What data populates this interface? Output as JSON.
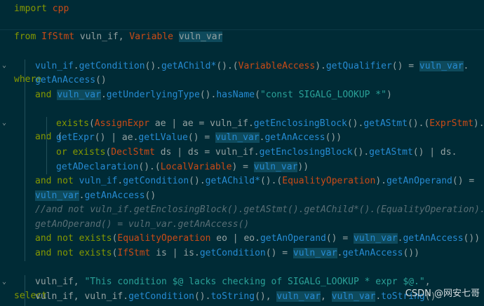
{
  "editor": {
    "lines": [
      [
        {
          "t": "import ",
          "c": "t-kw"
        },
        {
          "t": "cpp",
          "c": "t-type"
        }
      ],
      [],
      [
        {
          "t": "from ",
          "c": "t-kw"
        },
        {
          "t": "IfStmt",
          "c": "t-type"
        },
        {
          "t": " vuln_if, ",
          "c": "t-plain"
        },
        {
          "t": "Variable",
          "c": "t-type"
        },
        {
          "t": " ",
          "c": "t-plain"
        },
        {
          "t": "vuln_var",
          "c": "t-plain t-hl"
        }
      ],
      [
        {
          "t": "where",
          "c": "t-kw"
        }
      ],
      [
        {
          "t": "vuln_if",
          "c": "t-var"
        },
        {
          "t": ".",
          "c": "t-plain"
        },
        {
          "t": "getCondition",
          "c": "t-fn"
        },
        {
          "t": "().",
          "c": "t-plain"
        },
        {
          "t": "getAChild*",
          "c": "t-fn"
        },
        {
          "t": "().(",
          "c": "t-plain"
        },
        {
          "t": "VariableAccess",
          "c": "t-type"
        },
        {
          "t": ").",
          "c": "t-plain"
        },
        {
          "t": "getQualifier",
          "c": "t-fn"
        },
        {
          "t": "() = ",
          "c": "t-plain"
        },
        {
          "t": "vuln_var",
          "c": "t-var t-hl"
        },
        {
          "t": ".",
          "c": "t-plain"
        }
      ],
      [
        {
          "t": "getAnAccess",
          "c": "t-fn"
        },
        {
          "t": "()",
          "c": "t-plain"
        }
      ],
      [
        {
          "t": "and ",
          "c": "t-kw"
        },
        {
          "t": "vuln_var",
          "c": "t-var t-hl"
        },
        {
          "t": ".",
          "c": "t-plain"
        },
        {
          "t": "getUnderlyingType",
          "c": "t-fn"
        },
        {
          "t": "().",
          "c": "t-plain"
        },
        {
          "t": "hasName",
          "c": "t-fn"
        },
        {
          "t": "(",
          "c": "t-plain"
        },
        {
          "t": "\"const SIGALG_LOOKUP *\"",
          "c": "t-str"
        },
        {
          "t": ")",
          "c": "t-plain"
        }
      ],
      [
        {
          "t": "and ",
          "c": "t-kw"
        },
        {
          "t": "(",
          "c": "t-plain"
        }
      ],
      [
        {
          "t": "exists",
          "c": "t-kw"
        },
        {
          "t": "(",
          "c": "t-plain"
        },
        {
          "t": "AssignExpr",
          "c": "t-type"
        },
        {
          "t": " ae | ae = vuln_if.",
          "c": "t-plain"
        },
        {
          "t": "getEnclosingBlock",
          "c": "t-fn"
        },
        {
          "t": "().",
          "c": "t-plain"
        },
        {
          "t": "getAStmt",
          "c": "t-fn"
        },
        {
          "t": "().(",
          "c": "t-plain"
        },
        {
          "t": "ExprStmt",
          "c": "t-type"
        },
        {
          "t": ").",
          "c": "t-plain"
        }
      ],
      [
        {
          "t": "getExpr",
          "c": "t-fn"
        },
        {
          "t": "() | ae.",
          "c": "t-plain"
        },
        {
          "t": "getLValue",
          "c": "t-fn"
        },
        {
          "t": "() = ",
          "c": "t-plain"
        },
        {
          "t": "vuln_var",
          "c": "t-var t-hl"
        },
        {
          "t": ".",
          "c": "t-plain"
        },
        {
          "t": "getAnAccess",
          "c": "t-fn"
        },
        {
          "t": "())",
          "c": "t-plain"
        }
      ],
      [
        {
          "t": "or ",
          "c": "t-kw"
        },
        {
          "t": "exists",
          "c": "t-kw"
        },
        {
          "t": "(",
          "c": "t-plain"
        },
        {
          "t": "DeclStmt",
          "c": "t-type"
        },
        {
          "t": " ds | ds = vuln_if.",
          "c": "t-plain"
        },
        {
          "t": "getEnclosingBlock",
          "c": "t-fn"
        },
        {
          "t": "().",
          "c": "t-plain"
        },
        {
          "t": "getAStmt",
          "c": "t-fn"
        },
        {
          "t": "() | ds.",
          "c": "t-plain"
        }
      ],
      [
        {
          "t": "getADeclaration",
          "c": "t-fn"
        },
        {
          "t": "().(",
          "c": "t-plain"
        },
        {
          "t": "LocalVariable",
          "c": "t-type"
        },
        {
          "t": ") = ",
          "c": "t-plain"
        },
        {
          "t": "vuln_var",
          "c": "t-var t-hl"
        },
        {
          "t": "))",
          "c": "t-plain"
        }
      ],
      [
        {
          "t": "and not ",
          "c": "t-kw"
        },
        {
          "t": "vuln_if",
          "c": "t-var"
        },
        {
          "t": ".",
          "c": "t-plain"
        },
        {
          "t": "getCondition",
          "c": "t-fn"
        },
        {
          "t": "().",
          "c": "t-plain"
        },
        {
          "t": "getAChild*",
          "c": "t-fn"
        },
        {
          "t": "().(",
          "c": "t-plain"
        },
        {
          "t": "EqualityOperation",
          "c": "t-type"
        },
        {
          "t": ").",
          "c": "t-plain"
        },
        {
          "t": "getAnOperand",
          "c": "t-fn"
        },
        {
          "t": "() =",
          "c": "t-plain"
        }
      ],
      [
        {
          "t": "vuln_var",
          "c": "t-var t-hl"
        },
        {
          "t": ".",
          "c": "t-plain"
        },
        {
          "t": "getAnAccess",
          "c": "t-fn"
        },
        {
          "t": "()",
          "c": "t-plain"
        }
      ],
      [
        {
          "t": "//and not vuln_if.getEnclosingBlock().getAStmt().getAChild*().(EqualityOperation).",
          "c": "t-com"
        }
      ],
      [
        {
          "t": "getAnOperand() = vuln_var.getAnAccess()",
          "c": "t-com"
        }
      ],
      [
        {
          "t": "and not ",
          "c": "t-kw"
        },
        {
          "t": "exists",
          "c": "t-kw"
        },
        {
          "t": "(",
          "c": "t-plain"
        },
        {
          "t": "EqualityOperation",
          "c": "t-type"
        },
        {
          "t": " eo | eo.",
          "c": "t-plain"
        },
        {
          "t": "getAnOperand",
          "c": "t-fn"
        },
        {
          "t": "() = ",
          "c": "t-plain"
        },
        {
          "t": "vuln_var",
          "c": "t-var t-hl"
        },
        {
          "t": ".",
          "c": "t-plain"
        },
        {
          "t": "getAnAccess",
          "c": "t-fn"
        },
        {
          "t": "())",
          "c": "t-plain"
        }
      ],
      [
        {
          "t": "and not ",
          "c": "t-kw"
        },
        {
          "t": "exists",
          "c": "t-kw"
        },
        {
          "t": "(",
          "c": "t-plain"
        },
        {
          "t": "IfStmt",
          "c": "t-type"
        },
        {
          "t": " is | is.",
          "c": "t-plain"
        },
        {
          "t": "getCondition",
          "c": "t-fn"
        },
        {
          "t": "() = ",
          "c": "t-plain"
        },
        {
          "t": "vuln_var",
          "c": "t-var t-hl"
        },
        {
          "t": ".",
          "c": "t-plain"
        },
        {
          "t": "getAnAccess",
          "c": "t-fn"
        },
        {
          "t": "())",
          "c": "t-plain"
        }
      ],
      [
        {
          "t": "select",
          "c": "t-kw"
        }
      ],
      [
        {
          "t": "vuln_if, ",
          "c": "t-plain"
        },
        {
          "t": "\"This condition $@ lacks checking of SIGALG_LOOKUP * expr $@.\"",
          "c": "t-str"
        },
        {
          "t": ",",
          "c": "t-plain"
        }
      ],
      [
        {
          "t": "vuln_if, vuln_if.",
          "c": "t-plain"
        },
        {
          "t": "getCondition",
          "c": "t-fn"
        },
        {
          "t": "().",
          "c": "t-plain"
        },
        {
          "t": "toString",
          "c": "t-fn"
        },
        {
          "t": "(), ",
          "c": "t-plain"
        },
        {
          "t": "vuln_var",
          "c": "t-var t-hl"
        },
        {
          "t": ", ",
          "c": "t-plain"
        },
        {
          "t": "vuln_var",
          "c": "t-var t-hl"
        },
        {
          "t": ".",
          "c": "t-plain"
        },
        {
          "t": "toString",
          "c": "t-fn"
        },
        {
          "t": "()",
          "c": "t-plain"
        }
      ]
    ],
    "watermark": "CSDN @网安七哥"
  }
}
